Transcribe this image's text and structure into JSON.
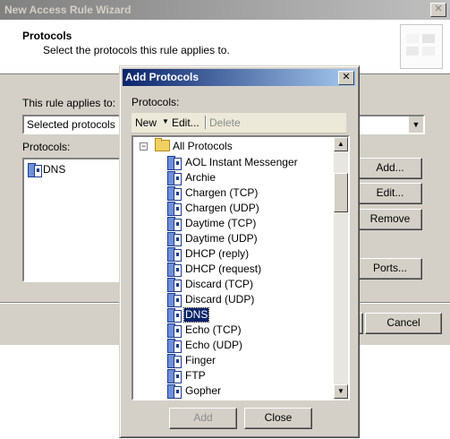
{
  "wizard": {
    "title": "New Access Rule Wizard",
    "close_glyph": "✕",
    "header_title": "Protocols",
    "header_subtitle": "Select the protocols this rule applies to.",
    "applies_label": "This rule applies to:",
    "applies_value": "Selected protocols",
    "protocols_label": "Protocols:",
    "list_items": [
      "DNS"
    ],
    "buttons": {
      "add": "Add...",
      "edit": "Edit...",
      "remove": "Remove",
      "ports": "Ports...",
      "cancel": "Cancel"
    }
  },
  "dialog": {
    "title": "Add Protocols",
    "close_glyph": "✕",
    "protocols_label": "Protocols:",
    "toolbar": {
      "new": "New",
      "edit": "Edit...",
      "delete": "Delete"
    },
    "tree": {
      "root": "All Protocols",
      "expander": "−",
      "items": [
        "AOL Instant Messenger",
        "Archie",
        "Chargen (TCP)",
        "Chargen (UDP)",
        "Daytime (TCP)",
        "Daytime (UDP)",
        "DHCP (reply)",
        "DHCP (request)",
        "Discard (TCP)",
        "Discard (UDP)",
        "DNS",
        "Echo (TCP)",
        "Echo (UDP)",
        "Finger",
        "FTP",
        "Gopher"
      ],
      "selected": "DNS"
    },
    "buttons": {
      "add": "Add",
      "close": "Close"
    }
  },
  "icons": {
    "protocol": "protocol-icon",
    "folder": "folder-icon",
    "scroll_up": "▲",
    "scroll_down": "▼",
    "dropdown": "▼"
  },
  "colors": {
    "active_title": "#0a246a",
    "inactive_title": "#808080",
    "face": "#d4d0c8",
    "selection": "#0a246a"
  }
}
